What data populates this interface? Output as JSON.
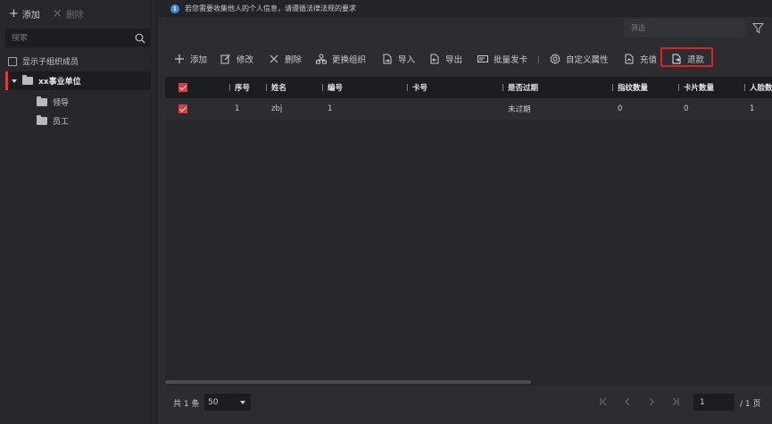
{
  "left": {
    "add_label": "添加",
    "delete_label": "删除",
    "search_placeholder": "搜索",
    "show_sub_members_label": "显示子组织成员",
    "tree": {
      "root_label": "xx事业单位",
      "children": [
        "领导",
        "员工"
      ]
    }
  },
  "notice": {
    "text": "若您需要收集他人的个人信息，请遵循法律法规的要求"
  },
  "filter": {
    "placeholder": "筛选"
  },
  "toolbar": {
    "items": [
      {
        "label": "添加",
        "icon": "plus-icon"
      },
      {
        "label": "修改",
        "icon": "edit-icon"
      },
      {
        "label": "删除",
        "icon": "close-icon"
      },
      {
        "label": "更换组织",
        "icon": "org-icon"
      },
      {
        "label": "导入",
        "icon": "import-icon"
      },
      {
        "label": "导出",
        "icon": "export-icon"
      },
      {
        "label": "批量发卡",
        "icon": "card-icon"
      },
      {
        "label": "自定义属性",
        "icon": "gear-icon"
      },
      {
        "label": "充值",
        "icon": "recharge-icon"
      },
      {
        "label": "退款",
        "icon": "refund-icon"
      }
    ],
    "highlight_color": "#e02424"
  },
  "table": {
    "headers": [
      "序号",
      "姓名",
      "编号",
      "卡号",
      "是否过期",
      "指纹数量",
      "卡片数量",
      "人脸数"
    ],
    "rows": [
      {
        "checked": true,
        "cells": [
          "1",
          "zbj",
          "1",
          "",
          "未过期",
          "0",
          "0",
          "1"
        ]
      }
    ]
  },
  "footer": {
    "total_text": "共 1 条",
    "page_size": "50",
    "current_page": "1",
    "total_pages": "/ 1 页"
  },
  "colors": {
    "accent": "#e03a3a",
    "info": "#3a8de0"
  }
}
